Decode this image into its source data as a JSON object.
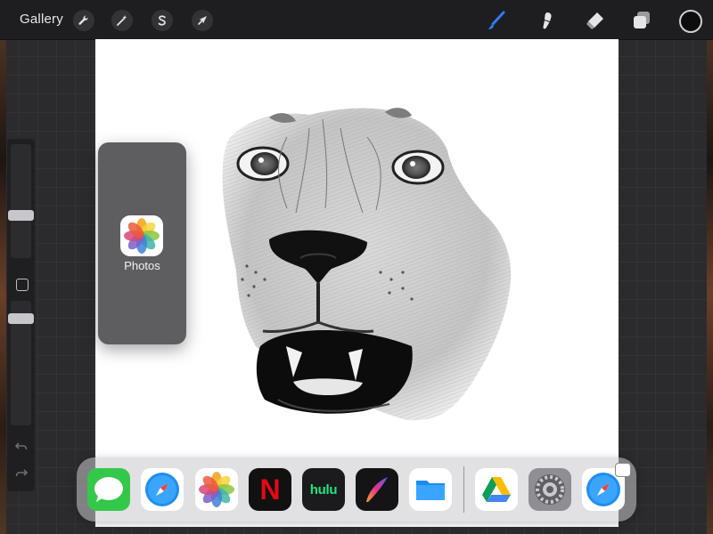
{
  "topbar": {
    "gallery_label": "Gallery",
    "left_tools": [
      "wrench-icon",
      "magic-wand-icon",
      "selection-s-icon",
      "arrow-cursor-icon"
    ],
    "right_tools": [
      "brush-icon",
      "smudge-icon",
      "eraser-icon",
      "layers-icon"
    ],
    "active_tool": "brush-icon",
    "accent_color": "#2f7cf6",
    "current_color": "#0d0d0d"
  },
  "sidebar": {
    "brush_size_label": "",
    "opacity_label": ""
  },
  "slideover": {
    "app_label": "Photos",
    "icon": "photos-icon"
  },
  "dock": {
    "apps": [
      {
        "name": "Messages",
        "icon": "messages-icon"
      },
      {
        "name": "Safari",
        "icon": "safari-icon"
      },
      {
        "name": "Photos",
        "icon": "photos-icon"
      },
      {
        "name": "Netflix",
        "icon": "netflix-icon",
        "glyph": "N"
      },
      {
        "name": "Hulu",
        "icon": "hulu-icon",
        "glyph": "hulu"
      },
      {
        "name": "Procreate",
        "icon": "procreate-icon"
      },
      {
        "name": "Files",
        "icon": "files-icon"
      },
      {
        "name": "Google Drive",
        "icon": "google-drive-icon"
      },
      {
        "name": "Settings",
        "icon": "settings-icon"
      },
      {
        "name": "Safari",
        "icon": "safari-icon"
      }
    ]
  },
  "canvas": {
    "artwork": "lion-face-sketch"
  }
}
